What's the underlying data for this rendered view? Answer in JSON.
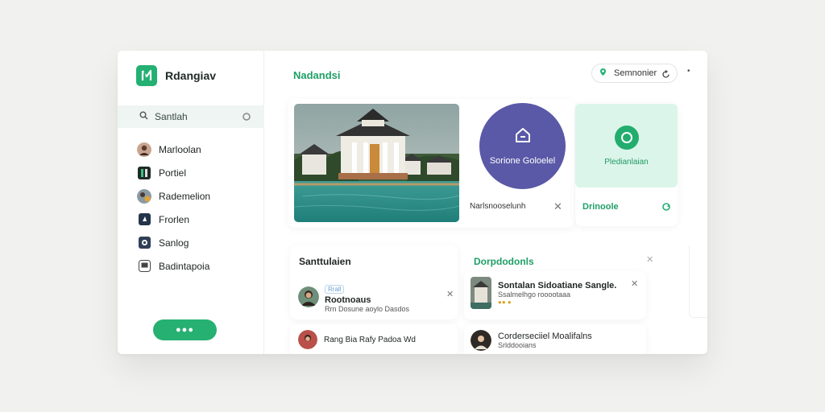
{
  "brand": {
    "name": "Rdangiav",
    "logo_icon": "brand-logo-icon"
  },
  "sidebar": {
    "search_label": "Santlah",
    "items": [
      {
        "label": "Marloolan",
        "icon": "avatar-icon"
      },
      {
        "label": "Portiel",
        "icon": "portal-icon"
      },
      {
        "label": "Rademelion",
        "icon": "group-icon"
      },
      {
        "label": "Frorlen",
        "icon": "file-icon"
      },
      {
        "label": "Sanlog",
        "icon": "log-icon"
      },
      {
        "label": "Badintapoia",
        "icon": "archive-icon"
      }
    ],
    "cta_label": "●●●"
  },
  "main": {
    "title": "Nadandsi",
    "top_button": "Semnonier",
    "more_glyph": "•",
    "feature": {
      "circle_caption": "Sorione Goloelel",
      "label": "Narlsnooselunh"
    },
    "mint": {
      "caption": "Pledianlaian",
      "status": "Drinoole"
    },
    "left_section": {
      "title": "Santtulaien",
      "rows": [
        {
          "tag": "Rrall",
          "title": "Rootnoaus",
          "sub": "Rrn Dosune aoylo Dasdos"
        },
        {
          "title": "Rang Bia Rafy Padoa Wd"
        }
      ]
    },
    "right_section": {
      "title": "Dorpdodonls",
      "rows": [
        {
          "title": "Sontalan Sidoatiane Sangle.",
          "sub": "Ssalmelhgo rooootaaa",
          "rating": "●● ●"
        },
        {
          "title": "Corderseciiel Moalifalns",
          "sub": "Srlddooians"
        }
      ]
    }
  },
  "colors": {
    "accent": "#23b072",
    "purple": "#5a59a7",
    "mint": "#dcf5ea"
  }
}
